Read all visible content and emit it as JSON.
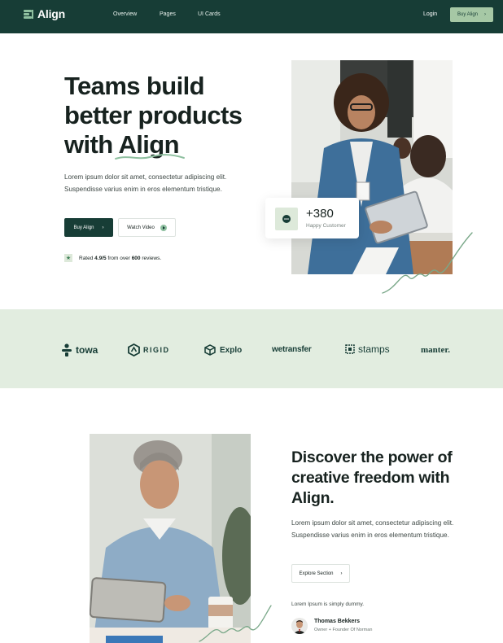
{
  "nav": {
    "brand": "Align",
    "links": [
      "Overview",
      "Pages",
      "UI Cards"
    ],
    "login": "Login",
    "buy": "Buy Align",
    "buy_arrow": "›"
  },
  "hero": {
    "title_line1": "Teams build",
    "title_line2": "better products",
    "title_line3": "with Align",
    "description": "Lorem ipsum dolor sit amet, consectetur adipiscing elit. Suspendisse varius enim in eros elementum tristique.",
    "buy_button": "Buy Align",
    "buy_arrow": "›",
    "video_button": "Watch Video",
    "rating_prefix": "Rated ",
    "rating_score": "4.9/5",
    "rating_middle": " from over ",
    "rating_count": "600",
    "rating_suffix": " reviews.",
    "counter_value": "+380",
    "counter_label": "Happy Customer"
  },
  "logos": [
    "towa",
    "RIGID",
    "Explo",
    "wetransfer",
    "stamps",
    "manter."
  ],
  "section2": {
    "title": "Discover the power of creative freedom with Align.",
    "description": "Lorem ipsum dolor sit amet, consectetur adipiscing elit. Suspendisse varius enim in eros elementum tristique.",
    "explore_button": "Explore Section",
    "explore_arrow": "›",
    "quote": "Lorem Ipsum is simply dummy.",
    "author_name": "Thomas Bekkers",
    "author_role": "Owner + Founder Of Norman"
  },
  "colors": {
    "nav_bg": "#173d36",
    "accent_green": "#a6c8a5",
    "strip_bg": "#e2ede0",
    "dark_button": "#173d36"
  }
}
